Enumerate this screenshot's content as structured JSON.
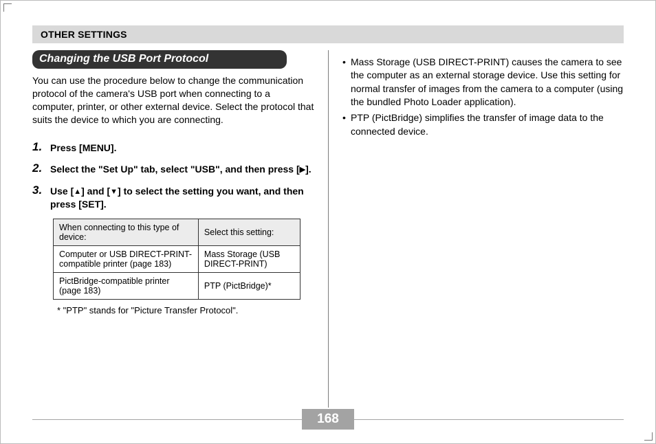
{
  "header": {
    "title": "OTHER SETTINGS"
  },
  "section": {
    "title": "Changing the USB Port Protocol",
    "intro": "You can use the procedure below to change the communication protocol of the camera's USB port when connecting to a computer, printer, or other external device. Select the protocol that suits the device to which you are connecting."
  },
  "steps": [
    {
      "num": "1.",
      "body": "Press [MENU]."
    },
    {
      "num": "2.",
      "body_pre": "Select the \"Set Up\" tab, select \"USB\", and then press [",
      "body_post": "]."
    },
    {
      "num": "3.",
      "body_pre": "Use [",
      "body_mid": "] and [",
      "body_post": "] to select the setting you want, and then press [SET]."
    }
  ],
  "table": {
    "head": {
      "c0": "When connecting to this type of device:",
      "c1": "Select this setting:"
    },
    "rows": [
      {
        "c0": "Computer or USB DIRECT-PRINT-compatible printer (page 183)",
        "c1": "Mass Storage (USB DIRECT-PRINT)"
      },
      {
        "c0": "PictBridge-compatible printer (page 183)",
        "c1": "PTP (PictBridge)*"
      }
    ]
  },
  "footnote": "* \"PTP\" stands for \"Picture Transfer Protocol\".",
  "right_bullets": [
    "Mass Storage (USB DIRECT-PRINT) causes the camera to see the computer as an external storage device. Use this setting for normal transfer of images from the camera to a computer (using the bundled Photo Loader application).",
    "PTP (PictBridge) simplifies the transfer of image data to the connected device."
  ],
  "page_number": "168",
  "glyphs": {
    "right": "▶",
    "up": "▲",
    "down": "▼"
  }
}
